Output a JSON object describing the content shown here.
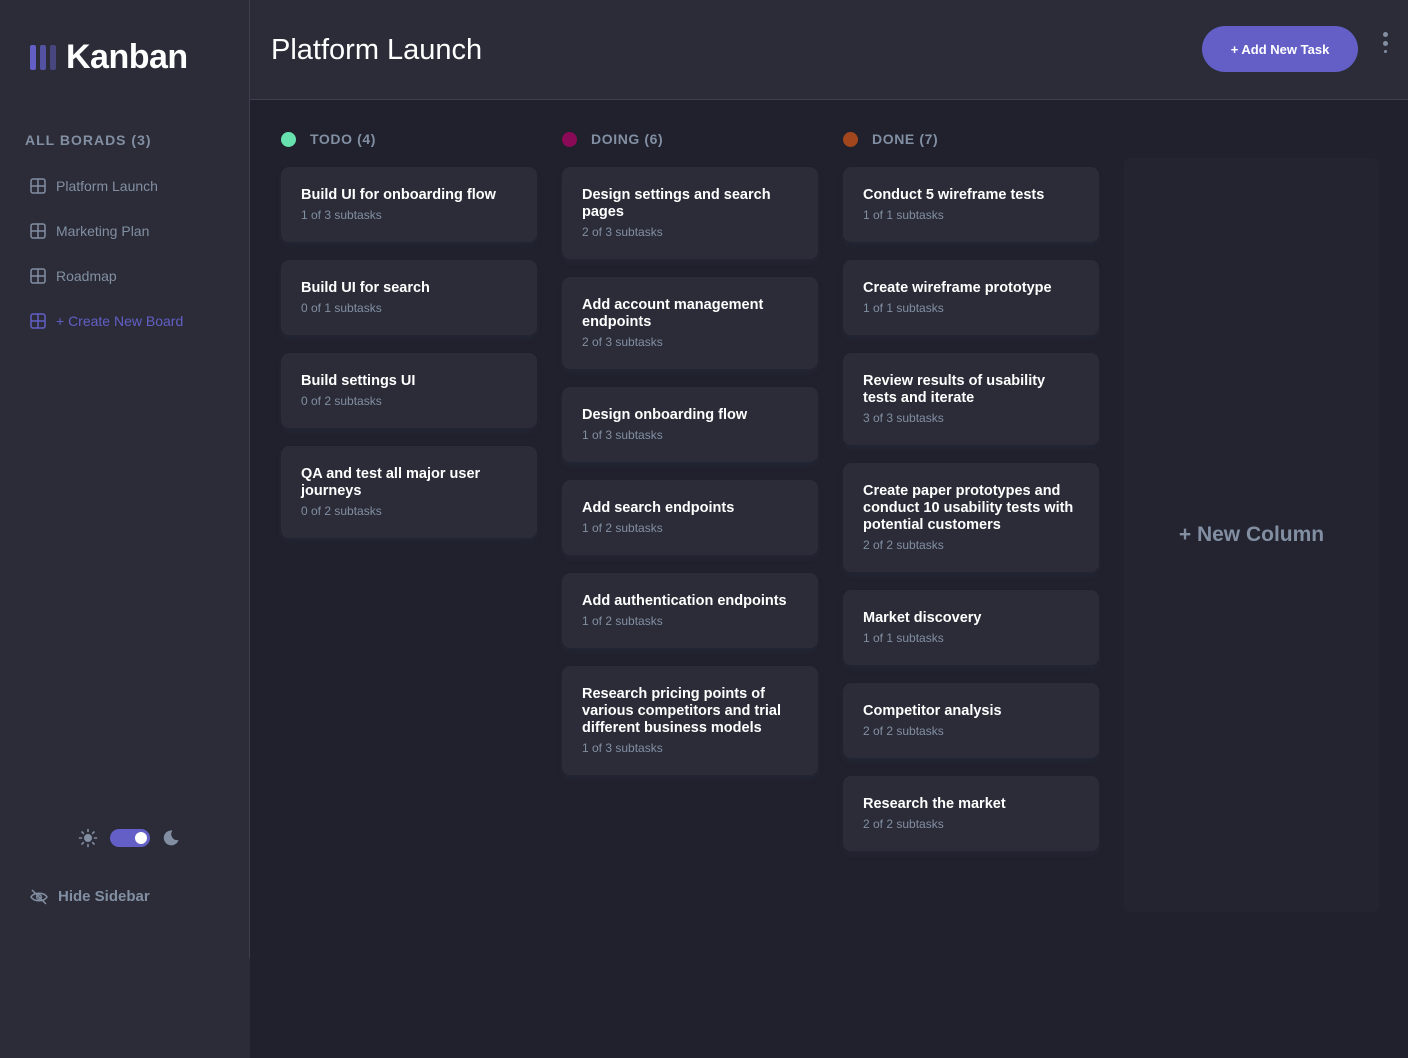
{
  "app": {
    "logo_text": "Kanban"
  },
  "sidebar": {
    "heading": "ALL BORADS (3)",
    "boards": [
      {
        "label": "Platform Launch"
      },
      {
        "label": "Marketing Plan"
      },
      {
        "label": "Roadmap"
      }
    ],
    "create_label": "+ Create New Board",
    "hide_label": "Hide Sidebar",
    "theme": {
      "mode": "dark"
    }
  },
  "header": {
    "title": "Platform Launch",
    "add_task_label": "+ Add New Task"
  },
  "columns": [
    {
      "title": "TODO (4)",
      "color": "#67e2ae",
      "cards": [
        {
          "title": "Build UI for onboarding flow",
          "subtasks": "1 of 3 subtasks"
        },
        {
          "title": "Build UI for search",
          "subtasks": "0 of 1 subtasks"
        },
        {
          "title": "Build settings UI",
          "subtasks": "0 of 2 subtasks"
        },
        {
          "title": "QA and test all major user journeys",
          "subtasks": "0 of 2 subtasks"
        }
      ]
    },
    {
      "title": "DOING (6)",
      "color": "#8b0a57",
      "cards": [
        {
          "title": "Design settings and search pages",
          "subtasks": "2 of 3 subtasks"
        },
        {
          "title": "Add account management endpoints",
          "subtasks": "2 of 3 subtasks"
        },
        {
          "title": "Design onboarding flow",
          "subtasks": "1 of 3 subtasks"
        },
        {
          "title": "Add search endpoints",
          "subtasks": "1 of 2 subtasks"
        },
        {
          "title": "Add authentication endpoints",
          "subtasks": "1 of 2 subtasks"
        },
        {
          "title": "Research pricing points of various competitors and trial different business models",
          "subtasks": "1 of 3 subtasks"
        }
      ]
    },
    {
      "title": "DONE (7)",
      "color": "#a2471d",
      "cards": [
        {
          "title": "Conduct 5 wireframe tests",
          "subtasks": "1 of 1 subtasks"
        },
        {
          "title": "Create wireframe prototype",
          "subtasks": "1 of 1 subtasks"
        },
        {
          "title": "Review results of usability tests and iterate",
          "subtasks": "3 of 3 subtasks"
        },
        {
          "title": "Create paper prototypes and conduct 10 usability tests with potential customers",
          "subtasks": "2 of 2 subtasks"
        },
        {
          "title": "Market discovery",
          "subtasks": "1 of 1 subtasks"
        },
        {
          "title": "Competitor analysis",
          "subtasks": "2 of 2 subtasks"
        },
        {
          "title": "Research the market",
          "subtasks": "2 of 2 subtasks"
        }
      ]
    }
  ],
  "new_column_label": "+ New Column",
  "colors": {
    "accent": "#635fc7",
    "background": "#20212c",
    "panel": "#2b2c37",
    "muted": "#828fa3"
  }
}
